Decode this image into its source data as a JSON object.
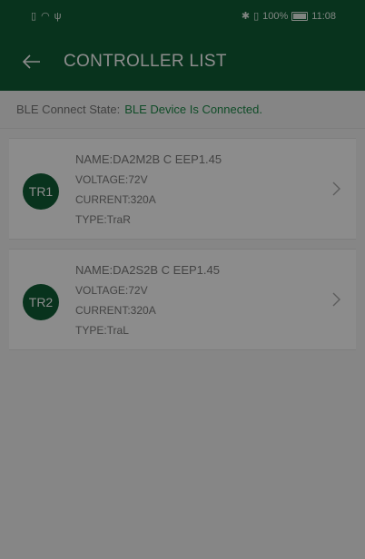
{
  "status_bar": {
    "time": "11:08",
    "battery_percent": "100%"
  },
  "app_bar": {
    "title": "CONTROLLER LIST"
  },
  "ble": {
    "label": "BLE Connect State:",
    "value": "BLE Device Is Connected."
  },
  "controllers": [
    {
      "badge": "TR1",
      "name": "NAME:DA2M2B C EEP1.45",
      "voltage": "VOLTAGE:72V",
      "current": "CURRENT:320A",
      "type": "TYPE:TraR"
    },
    {
      "badge": "TR2",
      "name": "NAME:DA2S2B C EEP1.45",
      "voltage": "VOLTAGE:72V",
      "current": "CURRENT:320A",
      "type": "TYPE:TraL"
    }
  ],
  "colors": {
    "primary": "#0f5d35",
    "accent_text": "#1e8b4a",
    "overlay": "#000000"
  },
  "icons": {
    "back": "arrow-left-icon",
    "chevron": "chevron-right-icon"
  }
}
